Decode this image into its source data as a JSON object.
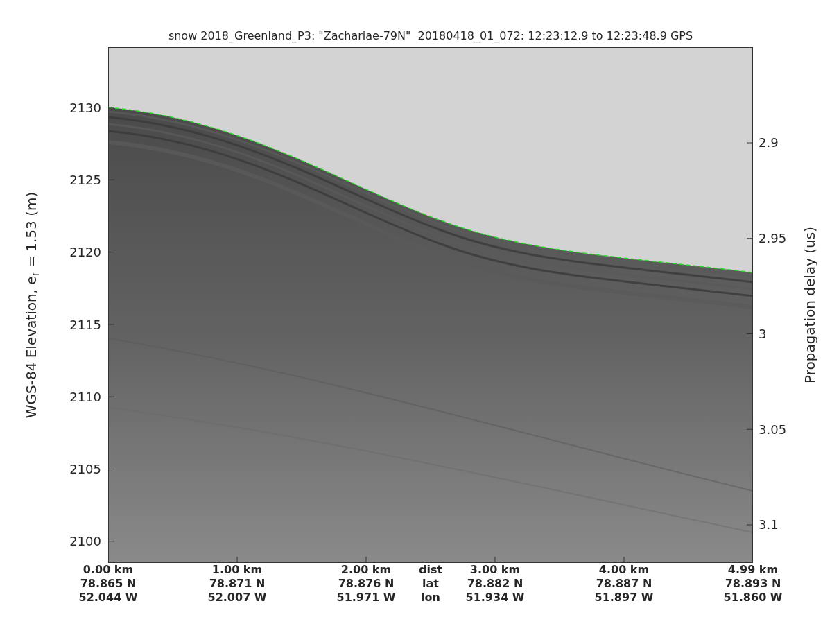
{
  "figure": {
    "title": "snow 2018_Greenland_P3: \"Zachariae-79N\"  20180418_01_072: 12:23:12.9 to 12:23:48.9 GPS",
    "y_label": "WGS-84 Elevation, e$_{r}$ = 1.53 (m)",
    "right_label": "Propagation delay (us)",
    "y_ticks": [
      "2130",
      "2125",
      "2120",
      "2115",
      "2110",
      "2105",
      "2100"
    ],
    "right_ticks": [
      "2.9",
      "2.95",
      "3",
      "3.05",
      "3.1"
    ],
    "x_columns": [
      {
        "lines": [
          "0.00 km",
          "78.865 N",
          "52.044 W"
        ]
      },
      {
        "lines": [
          "1.00 km",
          "78.871 N",
          "52.007 W"
        ]
      },
      {
        "lines": [
          "2.00 km",
          "78.876 N",
          "51.971 W"
        ]
      },
      {
        "lines": [
          "3.00 km",
          "78.882 N",
          "51.934 W"
        ]
      },
      {
        "lines": [
          "4.00 km",
          "78.887 N",
          "51.897 W"
        ]
      },
      {
        "lines": [
          "4.99 km",
          "78.893 N",
          "51.860 W"
        ]
      }
    ],
    "x_legend": [
      "dist",
      "lat",
      "lon"
    ]
  }
}
